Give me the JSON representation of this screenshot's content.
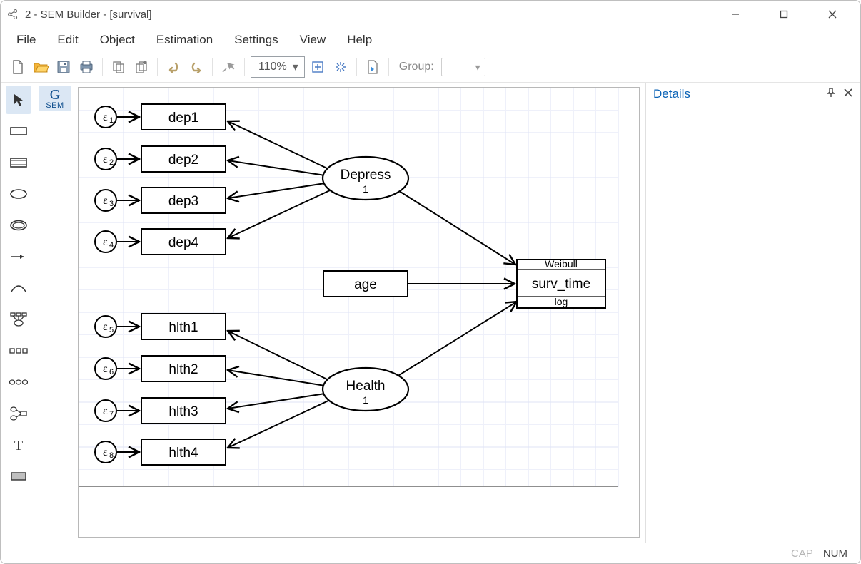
{
  "window": {
    "title": "2 - SEM Builder - [survival]"
  },
  "menu": {
    "file": "File",
    "edit": "Edit",
    "object": "Object",
    "estimation": "Estimation",
    "settings": "Settings",
    "view": "View",
    "help": "Help"
  },
  "toolbar": {
    "zoom": "110%",
    "group_label": "Group:"
  },
  "palette": {
    "gsem_top": "G",
    "gsem_bottom": "SEM"
  },
  "details": {
    "title": "Details"
  },
  "status": {
    "cap": "CAP",
    "num": "NUM"
  },
  "diagram": {
    "latent": {
      "depress": {
        "label": "Depress",
        "scale": "1"
      },
      "health": {
        "label": "Health",
        "scale": "1"
      }
    },
    "indicators": {
      "dep1": "dep1",
      "dep2": "dep2",
      "dep3": "dep3",
      "dep4": "dep4",
      "hlth1": "hlth1",
      "hlth2": "hlth2",
      "hlth3": "hlth3",
      "hlth4": "hlth4",
      "age": "age"
    },
    "outcome": {
      "name": "surv_time",
      "family": "Weibull",
      "link": "log"
    },
    "errors": {
      "e1": "1",
      "e2": "2",
      "e3": "3",
      "e4": "4",
      "e5": "5",
      "e6": "6",
      "e7": "7",
      "e8": "8"
    }
  }
}
